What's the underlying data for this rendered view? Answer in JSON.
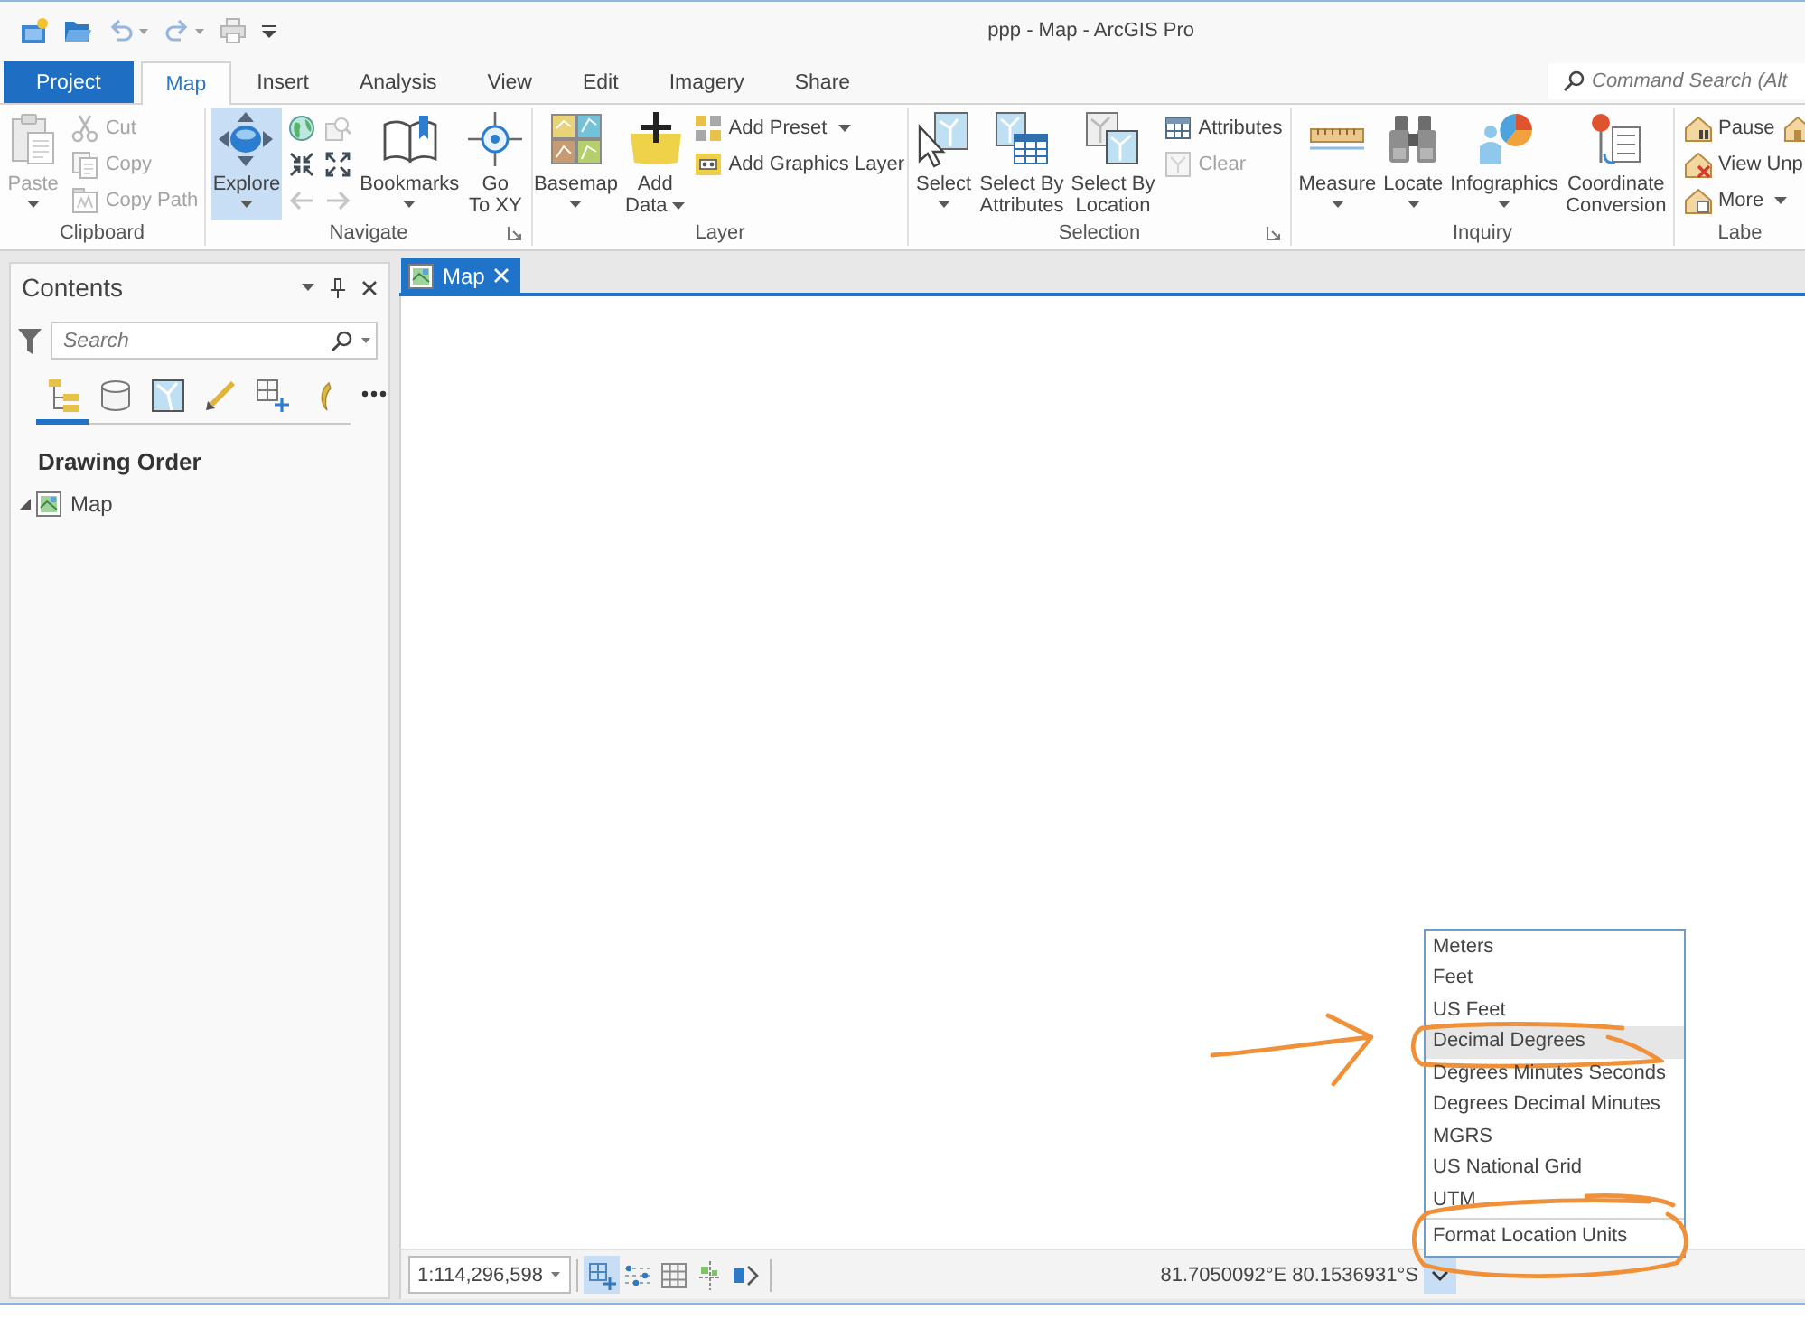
{
  "window": {
    "title": "ppp - Map - ArcGIS Pro"
  },
  "quick_access": [
    {
      "kind": "new",
      "disabled": false
    },
    {
      "kind": "open",
      "disabled": false
    },
    {
      "kind": "undo",
      "disabled": true
    },
    {
      "kind": "redo",
      "disabled": true
    },
    {
      "kind": "print",
      "disabled": true
    },
    {
      "kind": "customize",
      "disabled": false
    }
  ],
  "tabs": [
    {
      "label": "Project",
      "kind": "backstage",
      "selected": false
    },
    {
      "label": "Map",
      "kind": "tab",
      "selected": true
    },
    {
      "label": "Insert",
      "kind": "tab",
      "selected": false
    },
    {
      "label": "Analysis",
      "kind": "tab",
      "selected": false
    },
    {
      "label": "View",
      "kind": "tab",
      "selected": false
    },
    {
      "label": "Edit",
      "kind": "tab",
      "selected": false
    },
    {
      "label": "Imagery",
      "kind": "tab",
      "selected": false
    },
    {
      "label": "Share",
      "kind": "tab",
      "selected": false
    }
  ],
  "command_search": {
    "placeholder": "Command Search (Alt"
  },
  "ribbon": [
    {
      "label": "Clipboard",
      "launcher": false,
      "controls": [
        {
          "kind": "large",
          "label": "Paste",
          "caret": true,
          "disabled": true,
          "selected": false
        },
        {
          "kind": "stack",
          "buttons": [
            {
              "label": "Cut",
              "caret": false,
              "disabled": true
            },
            {
              "label": "Copy",
              "caret": false,
              "disabled": true
            },
            {
              "label": "Copy Path",
              "caret": false,
              "disabled": true
            }
          ]
        }
      ]
    },
    {
      "label": "Navigate",
      "launcher": true,
      "controls": [
        {
          "kind": "large",
          "label": "Explore",
          "caret": true,
          "disabled": false,
          "selected": true
        },
        {
          "kind": "grid",
          "buttons": [
            {
              "disabled": false
            },
            {
              "disabled": true
            },
            {
              "disabled": false
            },
            {
              "disabled": false
            },
            {
              "disabled": true
            },
            {
              "disabled": true
            }
          ]
        },
        {
          "kind": "large",
          "label": "Bookmarks",
          "caret": true,
          "disabled": false,
          "selected": false
        },
        {
          "kind": "large",
          "label": "Go\nTo XY",
          "caret": false,
          "disabled": false,
          "selected": false
        }
      ]
    },
    {
      "label": "Layer",
      "launcher": false,
      "controls": [
        {
          "kind": "large",
          "label": "Basemap",
          "caret": true,
          "disabled": false,
          "selected": false
        },
        {
          "kind": "large",
          "label": "Add\nData",
          "caret": true,
          "disabled": false,
          "selected": false
        },
        {
          "kind": "stack",
          "buttons": [
            {
              "label": "Add Preset",
              "caret": true,
              "disabled": false
            },
            {
              "label": "Add Graphics Layer",
              "caret": false,
              "disabled": false
            }
          ]
        }
      ]
    },
    {
      "label": "Selection",
      "launcher": true,
      "controls": [
        {
          "kind": "large",
          "label": "Select",
          "caret": true,
          "disabled": false,
          "selected": false
        },
        {
          "kind": "large",
          "label": "Select By\nAttributes",
          "caret": false,
          "disabled": false,
          "selected": false
        },
        {
          "kind": "large",
          "label": "Select By\nLocation",
          "caret": false,
          "disabled": false,
          "selected": false
        },
        {
          "kind": "stack",
          "buttons": [
            {
              "label": "Attributes",
              "caret": false,
              "disabled": false
            },
            {
              "label": "Clear",
              "caret": false,
              "disabled": true
            }
          ]
        }
      ]
    },
    {
      "label": "Inquiry",
      "launcher": false,
      "controls": [
        {
          "kind": "large",
          "label": "Measure",
          "caret": true,
          "disabled": false,
          "selected": false
        },
        {
          "kind": "large",
          "label": "Locate",
          "caret": true,
          "disabled": false,
          "selected": false
        },
        {
          "kind": "large",
          "label": "Infographics",
          "caret": true,
          "disabled": false,
          "selected": false
        },
        {
          "kind": "large",
          "label": "Coordinate\nConversion",
          "caret": false,
          "disabled": false,
          "selected": false
        }
      ]
    },
    {
      "label": "Labe",
      "launcher": false,
      "controls": [
        {
          "kind": "rows",
          "rows": [
            [
              {
                "label": "Pause",
                "caret": false,
                "disabled": false
              },
              {
                "caret": false,
                "disabled": false
              }
            ],
            [
              {
                "label": "View Unp",
                "caret": false,
                "disabled": false
              }
            ],
            [
              {
                "label": "More",
                "caret": true,
                "disabled": false
              }
            ]
          ]
        }
      ]
    }
  ],
  "contents": {
    "title": "Contents",
    "search": {
      "placeholder": "Search"
    },
    "view_tabs": [
      {
        "selected": true
      },
      {
        "selected": false
      },
      {
        "selected": false
      },
      {
        "selected": false
      },
      {
        "selected": false
      },
      {
        "selected": false
      }
    ],
    "heading": "Drawing Order",
    "tree": [
      {
        "label": "Map",
        "expanded": true
      }
    ]
  },
  "map_tabs": [
    {
      "label": "Map",
      "selected": true
    }
  ],
  "status_bar": {
    "scale": "1:114,296,598",
    "tools": [
      {
        "selected": true
      },
      {
        "selected": false
      },
      {
        "selected": false
      },
      {
        "selected": false
      },
      {
        "selected": false
      }
    ],
    "coordinates": "81.7050092°E 80.1536931°S",
    "units_menu": {
      "open": true,
      "items": [
        {
          "label": "Meters",
          "selected": false,
          "circled": false,
          "arrow": false
        },
        {
          "label": "Feet",
          "selected": false,
          "circled": false,
          "arrow": false
        },
        {
          "label": "US Feet",
          "selected": false,
          "circled": false,
          "arrow": false
        },
        {
          "label": "Decimal Degrees",
          "selected": true,
          "circled": true,
          "arrow": true
        },
        {
          "label": "Degrees Minutes Seconds",
          "selected": false,
          "circled": false,
          "arrow": false
        },
        {
          "label": "Degrees Decimal Minutes",
          "selected": false,
          "circled": false,
          "arrow": false
        },
        {
          "label": "MGRS",
          "selected": false,
          "circled": false,
          "arrow": false
        },
        {
          "label": "US National Grid",
          "selected": false,
          "circled": false,
          "arrow": false
        },
        {
          "label": "UTM",
          "selected": false,
          "circled": false,
          "arrow": false
        }
      ],
      "footer": {
        "label": "Format Location Units",
        "circled": true
      }
    }
  }
}
